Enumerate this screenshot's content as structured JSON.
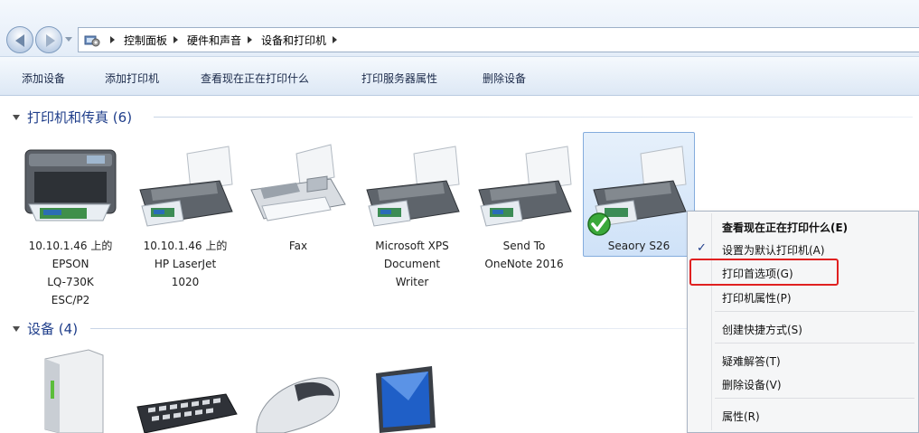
{
  "breadcrumb": {
    "items": [
      "控制面板",
      "硬件和声音",
      "设备和打印机"
    ]
  },
  "toolbar": {
    "buttons": [
      "添加设备",
      "添加打印机",
      "查看现在正在打印什么",
      "打印服务器属性",
      "删除设备"
    ]
  },
  "groups": [
    {
      "title": "打印机和传真",
      "count": "(6)"
    },
    {
      "title": "设备",
      "count": "(4)"
    }
  ],
  "printers": [
    {
      "label": "10.10.1.46 上的\nEPSON\nLQ-730K\nESC/P2",
      "icon": "multifunction-printer-icon"
    },
    {
      "label": "10.10.1.46 上的\nHP LaserJet\n1020",
      "icon": "printer-icon"
    },
    {
      "label": "Fax",
      "icon": "fax-icon"
    },
    {
      "label": "Microsoft XPS\nDocument\nWriter",
      "icon": "printer-icon"
    },
    {
      "label": "Send To\nOneNote 2016",
      "icon": "printer-icon"
    },
    {
      "label": "Seaory S26",
      "icon": "printer-icon",
      "default": true,
      "selected": true
    }
  ],
  "devices_icons": [
    "computer-tower-icon",
    "keyboard-icon",
    "mouse-icon",
    "monitor-icon"
  ],
  "context_menu": {
    "items": [
      {
        "label": "查看现在正在打印什么(E)",
        "bold": true
      },
      {
        "label": "设置为默认打印机(A)",
        "checked": true
      },
      {
        "label": "打印首选项(G)",
        "highlighted": true
      },
      {
        "label": "打印机属性(P)"
      },
      {
        "label": "创建快捷方式(S)"
      },
      {
        "label": "疑难解答(T)"
      },
      {
        "label": "删除设备(V)"
      },
      {
        "label": "属性(R)"
      }
    ]
  },
  "colors": {
    "group_header": "#1e3d8a",
    "highlight_box": "#e02020",
    "selection": "#cfe2f8"
  }
}
